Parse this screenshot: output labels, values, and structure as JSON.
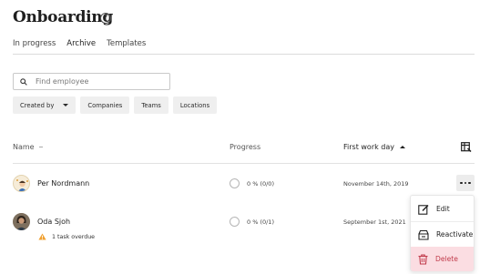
{
  "page": {
    "title": "Onboarding"
  },
  "tabs": [
    {
      "label": "In progress",
      "active": false
    },
    {
      "label": "Archive",
      "active": true
    },
    {
      "label": "Templates",
      "active": false
    }
  ],
  "search": {
    "placeholder": "Find employee",
    "value": ""
  },
  "filters": [
    {
      "label": "Created by",
      "dropdown": true
    },
    {
      "label": "Companies"
    },
    {
      "label": "Teams"
    },
    {
      "label": "Locations"
    }
  ],
  "table": {
    "columns": {
      "name": "Name",
      "progress": "Progress",
      "first_work_day": "First work day"
    },
    "rows": [
      {
        "name": "Per Nordmann",
        "progress": "0 % (0/0)",
        "progress_fraction": 0,
        "date": "November 14th, 2019"
      },
      {
        "name": "Oda Sjoh",
        "progress": "0 % (0/1)",
        "progress_fraction": 0,
        "date": "September 1st, 2021",
        "warning": "1 task overdue"
      }
    ]
  },
  "menu": {
    "items": [
      {
        "label": "Edit",
        "icon": "edit-icon"
      },
      {
        "label": "Reactivate",
        "icon": "reactivate-icon"
      },
      {
        "label": "Delete",
        "icon": "trash-icon"
      }
    ]
  },
  "colors": {
    "warning": "#f0a030",
    "danger_bg": "#fbdde2",
    "danger_text": "#c13c4c"
  }
}
